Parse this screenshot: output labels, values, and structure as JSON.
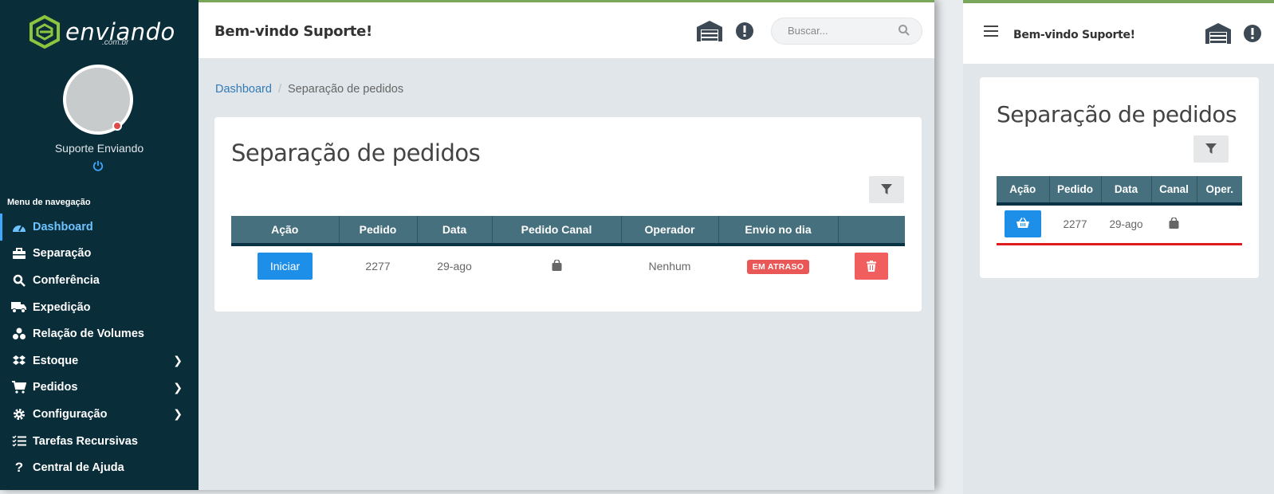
{
  "brand": {
    "name": "enviando",
    "suffix": ".com.br",
    "accent": "#7aa65c"
  },
  "user": {
    "name": "Suporte Enviando",
    "status_color": "#e04a4a"
  },
  "nav": {
    "title": "Menu de navegação",
    "items": [
      {
        "label": "Dashboard",
        "icon": "tachometer-icon"
      },
      {
        "label": "Separação",
        "icon": "briefcase-icon"
      },
      {
        "label": "Conferência",
        "icon": "search-icon"
      },
      {
        "label": "Expedição",
        "icon": "truck-icon"
      },
      {
        "label": "Relação de Volumes",
        "icon": "cubes-icon"
      },
      {
        "label": "Estoque",
        "icon": "dropbox-icon"
      },
      {
        "label": "Pedidos",
        "icon": "cart-icon"
      },
      {
        "label": "Configuração",
        "icon": "gear-icon"
      },
      {
        "label": "Tarefas Recursivas",
        "icon": "tasks-icon"
      },
      {
        "label": "Central de Ajuda",
        "icon": "question-icon"
      }
    ]
  },
  "header": {
    "welcome": "Bem-vindo Suporte!",
    "search_placeholder": "Buscar..."
  },
  "breadcrumb": {
    "root": "Dashboard",
    "current": "Separação de pedidos"
  },
  "page": {
    "title": "Separação de pedidos",
    "columns": [
      "Ação",
      "Pedido",
      "Data",
      "Pedido Canal",
      "Operador",
      "Envio no dia",
      ""
    ],
    "row": {
      "action": "Iniciar",
      "pedido": "2277",
      "data": "29-ago",
      "canal_icon": "shopping-bag-icon",
      "operador": "Nenhum",
      "status": "EM ATRASO"
    }
  },
  "mobile": {
    "welcome": "Bem-vindo Suporte!",
    "title": "Separação de pedidos",
    "columns": [
      "Ação",
      "Pedido",
      "Data",
      "Canal",
      "Oper."
    ],
    "row": {
      "pedido": "2277",
      "data": "29-ago"
    }
  }
}
